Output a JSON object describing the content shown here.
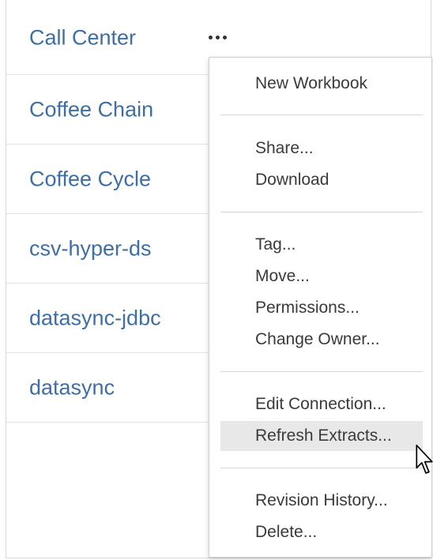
{
  "datasources": [
    {
      "name": "Call Center"
    },
    {
      "name": "Coffee Chain"
    },
    {
      "name": "Coffee Cycle"
    },
    {
      "name": "csv-hyper-ds"
    },
    {
      "name": "datasync-jdbc"
    },
    {
      "name": "datasync"
    }
  ],
  "more_button": {
    "icon": "ellipsis-icon"
  },
  "context_menu": {
    "items": [
      {
        "label": "New Workbook"
      },
      {
        "label": "Share..."
      },
      {
        "label": "Download"
      },
      {
        "label": "Tag..."
      },
      {
        "label": "Move..."
      },
      {
        "label": "Permissions..."
      },
      {
        "label": "Change Owner..."
      },
      {
        "label": "Edit Connection..."
      },
      {
        "label": "Refresh Extracts..."
      },
      {
        "label": "Revision History..."
      },
      {
        "label": "Delete..."
      }
    ],
    "highlighted_item": "Refresh Extracts..."
  },
  "colors": {
    "link_text": "#3d6ea6",
    "menu_text": "#3a3a3a",
    "highlight_bg": "#e8e8e8"
  },
  "cursor": {
    "icon": "mouse-pointer-icon"
  }
}
